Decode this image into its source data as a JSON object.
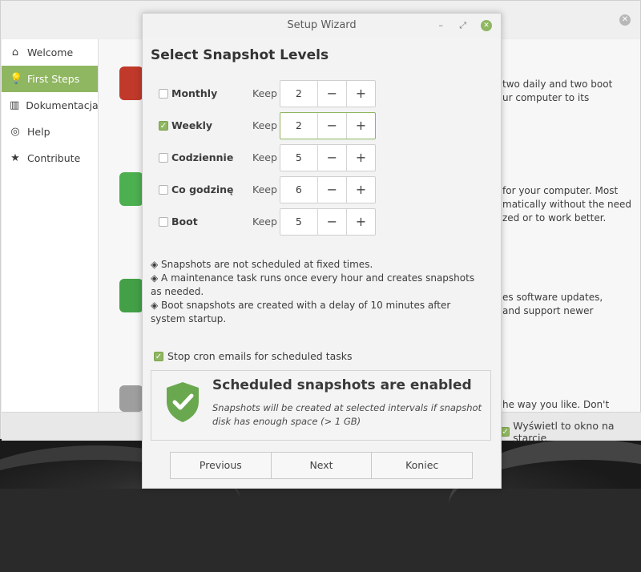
{
  "background_window": {
    "sidebar": [
      {
        "icon": "home-icon",
        "label": "Welcome",
        "active": false
      },
      {
        "icon": "lightbulb-icon",
        "label": "First Steps",
        "active": true
      },
      {
        "icon": "book-icon",
        "label": "Dokumentacja",
        "active": false
      },
      {
        "icon": "help-icon",
        "label": "Help",
        "active": false
      },
      {
        "icon": "star-icon",
        "label": "Contribute",
        "active": false
      }
    ],
    "texts": [
      "two daily and two boot",
      "ur computer to its",
      "for your computer. Most",
      "matically without the need",
      "zed or to work better.",
      "es software updates,",
      "and support newer",
      "he way you like. Don't"
    ],
    "startup_label": "Wyświetl to okno na starcie"
  },
  "dialog": {
    "title": "Setup Wizard",
    "heading": "Select Snapshot Levels",
    "keep_label": "Keep",
    "levels": [
      {
        "label": "Monthly",
        "checked": false,
        "value": "2"
      },
      {
        "label": "Weekly",
        "checked": true,
        "value": "2"
      },
      {
        "label": "Codziennie",
        "checked": false,
        "value": "5"
      },
      {
        "label": "Co godzinę",
        "checked": false,
        "value": "6"
      },
      {
        "label": "Boot",
        "checked": false,
        "value": "5"
      }
    ],
    "minus": "−",
    "plus": "+",
    "notes": [
      "◈ Snapshots are not scheduled at fixed times.",
      "◈ A maintenance task runs once every hour and creates snapshots as needed.",
      "◈ Boot snapshots are created with a delay of 10 minutes after system startup."
    ],
    "cron_label": "Stop cron emails for scheduled tasks",
    "status_title": "Scheduled snapshots are enabled",
    "status_desc": "Snapshots will be created at selected intervals if snapshot disk has enough space (> 1 GB)",
    "buttons": {
      "previous": "Previous",
      "next": "Next",
      "finish": "Koniec"
    }
  },
  "colors": {
    "accent": "#8fb660",
    "shield": "#6aa84f"
  }
}
